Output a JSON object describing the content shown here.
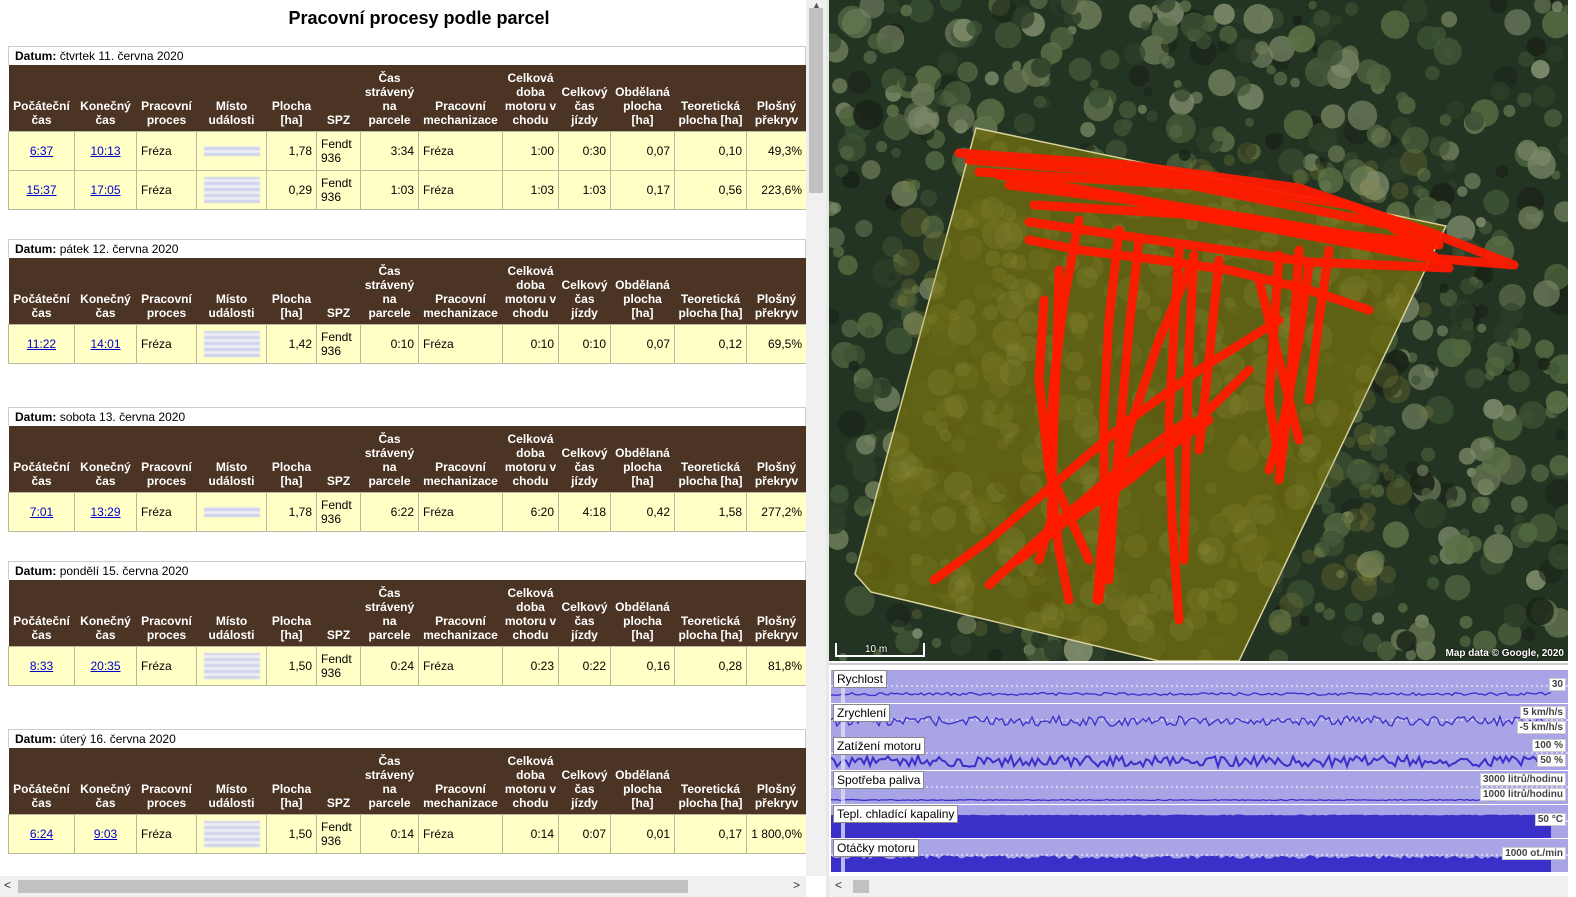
{
  "report": {
    "title": "Pracovní procesy podle parcel",
    "datum_label": "Datum:",
    "headers": [
      "Počáteční čas",
      "Konečný čas",
      "Pracovní proces",
      "Místo události",
      "Plocha [ha]",
      "SPZ",
      "Čas strávený na parcele",
      "Pracovní mechanizace",
      "Celková doba motoru v chodu",
      "Celkový čas jízdy",
      "Obdělaná plocha [ha]",
      "Teoretická plocha [ha]",
      "Plošný překryv"
    ],
    "days": [
      {
        "date": "čtvrtek 11. června 2020",
        "rows": [
          {
            "start": "6:37",
            "end": "10:13",
            "process": "Fréza",
            "plocha": "1,78",
            "spz": "Fendt 936",
            "cas_parcela": "3:34",
            "mechanizace": "Fréza",
            "motor": "1:00",
            "jizda": "0:30",
            "obdelana": "0,07",
            "teoreticka": "0,10",
            "prekryv": "49,3%"
          },
          {
            "start": "15:37",
            "end": "17:05",
            "process": "Fréza",
            "plocha": "0,29",
            "spz": "Fendt 936",
            "cas_parcela": "1:03",
            "mechanizace": "Fréza",
            "motor": "1:03",
            "jizda": "1:03",
            "obdelana": "0,17",
            "teoreticka": "0,56",
            "prekryv": "223,6%"
          }
        ]
      },
      {
        "date": "pátek 12. června 2020",
        "rows": [
          {
            "start": "11:22",
            "end": "14:01",
            "process": "Fréza",
            "plocha": "1,42",
            "spz": "Fendt 936",
            "cas_parcela": "0:10",
            "mechanizace": "Fréza",
            "motor": "0:10",
            "jizda": "0:10",
            "obdelana": "0,07",
            "teoreticka": "0,12",
            "prekryv": "69,5%"
          }
        ]
      },
      {
        "date": "sobota 13. června 2020",
        "rows": [
          {
            "start": "7:01",
            "end": "13:29",
            "process": "Fréza",
            "plocha": "1,78",
            "spz": "Fendt 936",
            "cas_parcela": "6:22",
            "mechanizace": "Fréza",
            "motor": "6:20",
            "jizda": "4:18",
            "obdelana": "0,42",
            "teoreticka": "1,58",
            "prekryv": "277,2%"
          }
        ]
      },
      {
        "date": "pondělí 15. června 2020",
        "rows": [
          {
            "start": "8:33",
            "end": "20:35",
            "process": "Fréza",
            "plocha": "1,50",
            "spz": "Fendt 936",
            "cas_parcela": "0:24",
            "mechanizace": "Fréza",
            "motor": "0:23",
            "jizda": "0:22",
            "obdelana": "0,16",
            "teoreticka": "0,28",
            "prekryv": "81,8%"
          }
        ]
      },
      {
        "date": "úterý 16. června 2020",
        "rows": [
          {
            "start": "6:24",
            "end": "9:03",
            "process": "Fréza",
            "plocha": "1,50",
            "spz": "Fendt 936",
            "cas_parcela": "0:14",
            "mechanizace": "Fréza",
            "motor": "0:14",
            "jizda": "0:07",
            "obdelana": "0,01",
            "teoreticka": "0,17",
            "prekryv": "1 800,0%"
          }
        ]
      }
    ]
  },
  "map": {
    "attribution": "Map data © Google, 2020",
    "scale_label": "10 m",
    "track_color": "#ff1a00",
    "parcel_color": "#6b6a10"
  },
  "graphs": {
    "tracks": [
      {
        "label": "Rychlost",
        "right_labels": [
          "30"
        ]
      },
      {
        "label": "Zrychlení",
        "right_labels": [
          "5 km/h/s",
          "-5 km/h/s"
        ]
      },
      {
        "label": "Zatížení motoru",
        "right_labels": [
          "100 %",
          "50 %"
        ]
      },
      {
        "label": "Spotřeba paliva",
        "right_labels": [
          "3000 litrů/hodinu",
          "1000 litrů/hodinu"
        ]
      },
      {
        "label": "Tepl. chladící kapaliny",
        "right_labels": [
          "50 °C"
        ]
      },
      {
        "label": "Otáčky motoru",
        "right_labels": [
          "1000 ot./min"
        ]
      }
    ],
    "fill_color": "#3a2fc9",
    "bg_color": "#a9a4e6"
  }
}
